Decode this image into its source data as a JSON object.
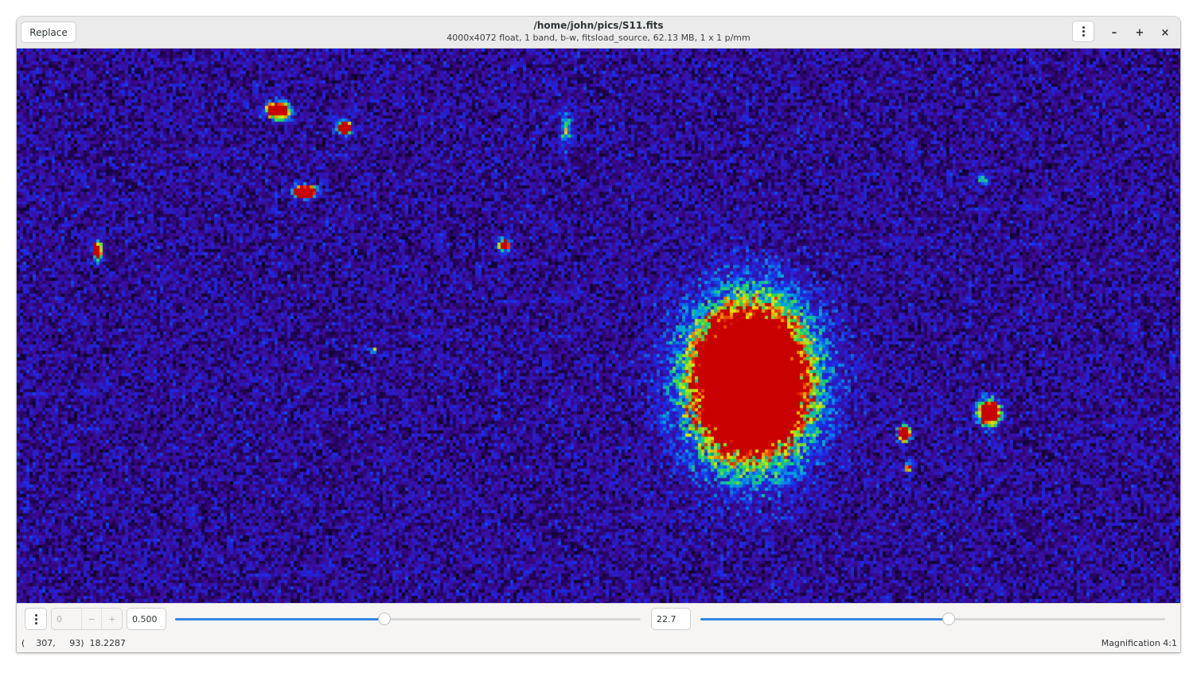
{
  "headerbar": {
    "replace_label": "Replace",
    "title": "/home/john/pics/S11.fits",
    "subtitle": "4000x4072 float, 1 band, b-w, fitsload_source, 62.13 MB, 1 x 1 p/mm",
    "minimize": "–",
    "maximize": "+",
    "close": "×"
  },
  "controls": {
    "page_value": "0",
    "page_minus": "−",
    "page_plus": "+",
    "scale_value": "0.500",
    "scale_fraction": 0.45,
    "offset_value": "22.7",
    "offset_fraction": 0.535
  },
  "statusbar": {
    "coords": "(    307,     93)  18.2287",
    "magnification": "Magnification 4:1"
  },
  "colors": {
    "accent": "#3584e4",
    "background_noise": "#3a0a8a"
  }
}
